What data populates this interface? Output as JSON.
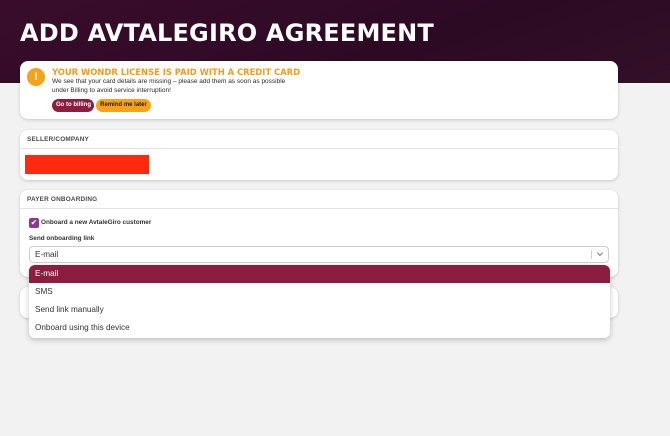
{
  "page": {
    "title": "ADD AVTALEGIRO AGREEMENT"
  },
  "alert": {
    "icon": "warning-icon",
    "icon_glyph": "!",
    "title": "YOUR WONDR LICENSE IS PAID WITH A CREDIT CARD",
    "text": "We see that your card details are missing – please add them as soon as possible under Billing to avoid service interruption!",
    "billing_button": "Go to billing",
    "remind_button": "Remind me later",
    "colors": {
      "accent": "#f7a21b",
      "primary": "#8c1c40"
    }
  },
  "seller": {
    "heading": "SELLER/COMPANY"
  },
  "payer": {
    "heading": "PAYER ONBOARDING",
    "checkbox_label": "Onboard a new AvtaleGiro customer",
    "checkbox_checked": true,
    "checkbox_glyph": "✔",
    "send_label": "Send onboarding link",
    "selected_value": "E-mail"
  },
  "dropdown": {
    "options": [
      "E-mail",
      "SMS",
      "Send link manually",
      "Onboard using this device"
    ],
    "selected_index": 0
  }
}
